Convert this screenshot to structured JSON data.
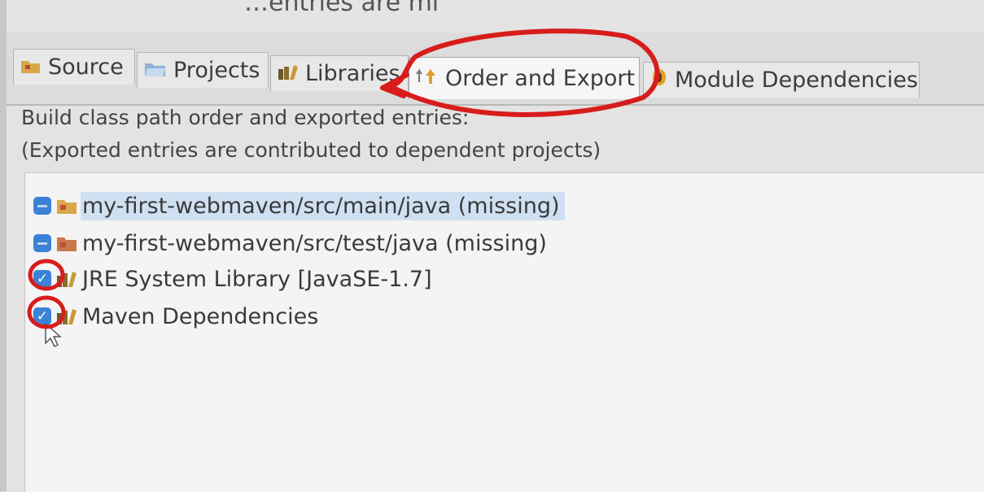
{
  "header": {
    "cut_text": "…entries are missing."
  },
  "tabs": [
    {
      "label": "Source",
      "icon": "source-folder-icon"
    },
    {
      "label": "Projects",
      "icon": "projects-folder-icon"
    },
    {
      "label": "Libraries",
      "icon": "libraries-icon"
    },
    {
      "label": "Order and Export",
      "icon": "order-export-icon",
      "active": true
    },
    {
      "label": "Module Dependencies",
      "icon": "module-icon"
    }
  ],
  "description": {
    "line1": "Build class path order and exported entries:",
    "line2": "(Exported entries are contributed to dependent projects)"
  },
  "entries": [
    {
      "label": "my-first-webmaven/src/main/java (missing)",
      "state": "partial",
      "icon": "source-folder-icon",
      "selected": true
    },
    {
      "label": "my-first-webmaven/src/test/java (missing)",
      "state": "partial",
      "icon": "source-folder-icon",
      "selected": false
    },
    {
      "label": "JRE System Library [JavaSE-1.7]",
      "state": "checked",
      "icon": "library-icon",
      "selected": false
    },
    {
      "label": "Maven Dependencies",
      "state": "checked",
      "icon": "library-icon",
      "selected": false
    }
  ],
  "colors": {
    "accent": "#3b82d6",
    "annotation": "#d81c1c",
    "selection": "#cfe0f2"
  }
}
